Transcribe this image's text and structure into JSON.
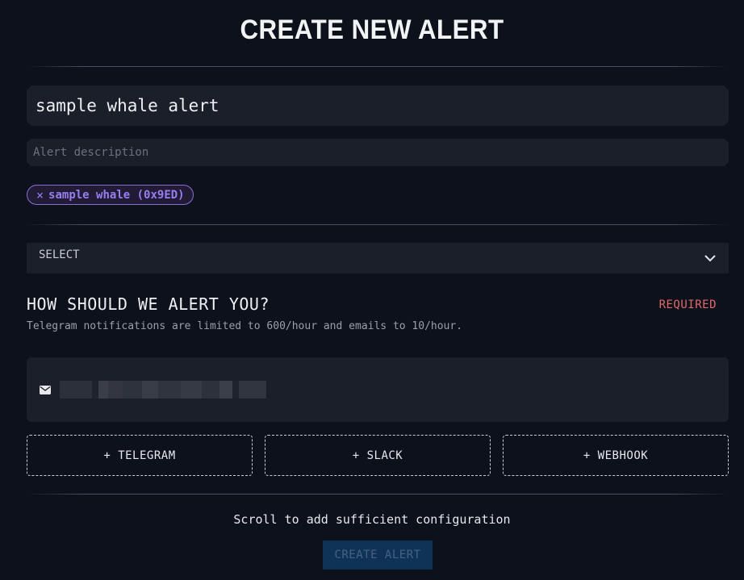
{
  "page": {
    "title": "CREATE NEW ALERT"
  },
  "form": {
    "name_value": "sample whale alert",
    "description_placeholder": "Alert description",
    "tag": {
      "close_glyph": "×",
      "label": "sample whale (0x9ED)"
    },
    "select_label": "SELECT"
  },
  "alerts": {
    "heading": "HOW SHOULD WE ALERT YOU?",
    "required_label": "REQUIRED",
    "note": "Telegram notifications are limited to 600/hour and emails to 10/hour.",
    "email_icon": "mail-icon",
    "add_buttons": [
      "+ TELEGRAM",
      "+ SLACK",
      "+ WEBHOOK"
    ]
  },
  "footer": {
    "scroll_note": "Scroll to add sufficient configuration",
    "create_label": "CREATE ALERT"
  },
  "colors": {
    "background": "#0d111b",
    "field": "#1b1f29",
    "tag_accent": "#9a7ef0",
    "required": "#e06a6a",
    "create_button_bg": "#0f3357"
  }
}
